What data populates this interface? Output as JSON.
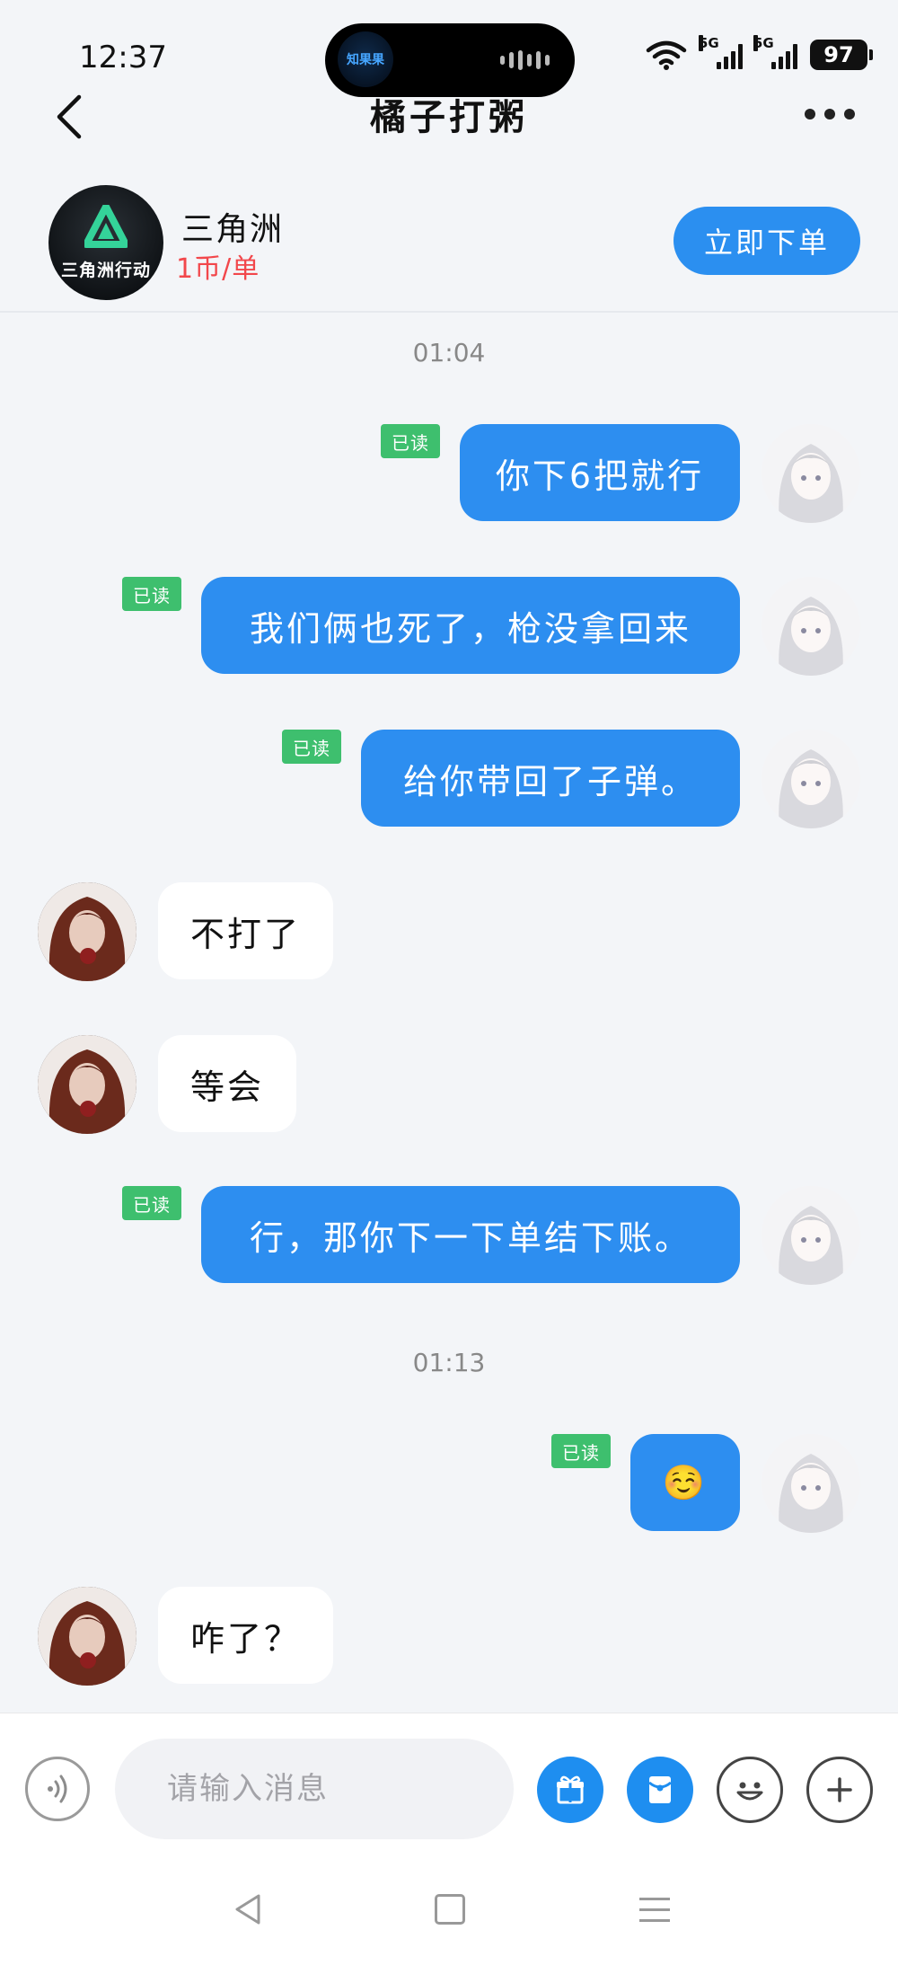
{
  "status_bar": {
    "time": "12:37",
    "island_app": "知果果",
    "network_1": "5G",
    "network_2": "5G",
    "battery": "97"
  },
  "header": {
    "title": "橘子打粥",
    "back_icon": "chevron-left-icon",
    "more_icon": "more-horizontal-icon"
  },
  "service": {
    "logo_text": "三角洲行动",
    "name": "三角洲",
    "price": "1币/单",
    "order_button": "立即下单",
    "accent_color": "#2b8ff0",
    "price_color": "#f2474b"
  },
  "chat": {
    "read_label": "已读",
    "messages": [
      {
        "type": "time",
        "text": "01:04"
      },
      {
        "type": "out",
        "text": "你下6把就行",
        "read": true
      },
      {
        "type": "out",
        "text": "我们俩也死了，枪没拿回来",
        "read": true
      },
      {
        "type": "out",
        "text": "给你带回了子弹。",
        "read": true
      },
      {
        "type": "in",
        "text": "不打了"
      },
      {
        "type": "in",
        "text": "等会"
      },
      {
        "type": "out",
        "text": "行，那你下一下单结下账。",
        "read": true
      },
      {
        "type": "time",
        "text": "01:13"
      },
      {
        "type": "out",
        "text": "☺️",
        "read": true
      },
      {
        "type": "in",
        "text": "咋了？"
      }
    ]
  },
  "input_bar": {
    "placeholder": "请输入消息",
    "icons": [
      "voice-icon",
      "gift-icon",
      "red-packet-icon",
      "emoji-icon",
      "plus-icon"
    ]
  },
  "nav_bar": {
    "icons": [
      "nav-back-icon",
      "nav-home-icon",
      "nav-menu-icon"
    ]
  }
}
